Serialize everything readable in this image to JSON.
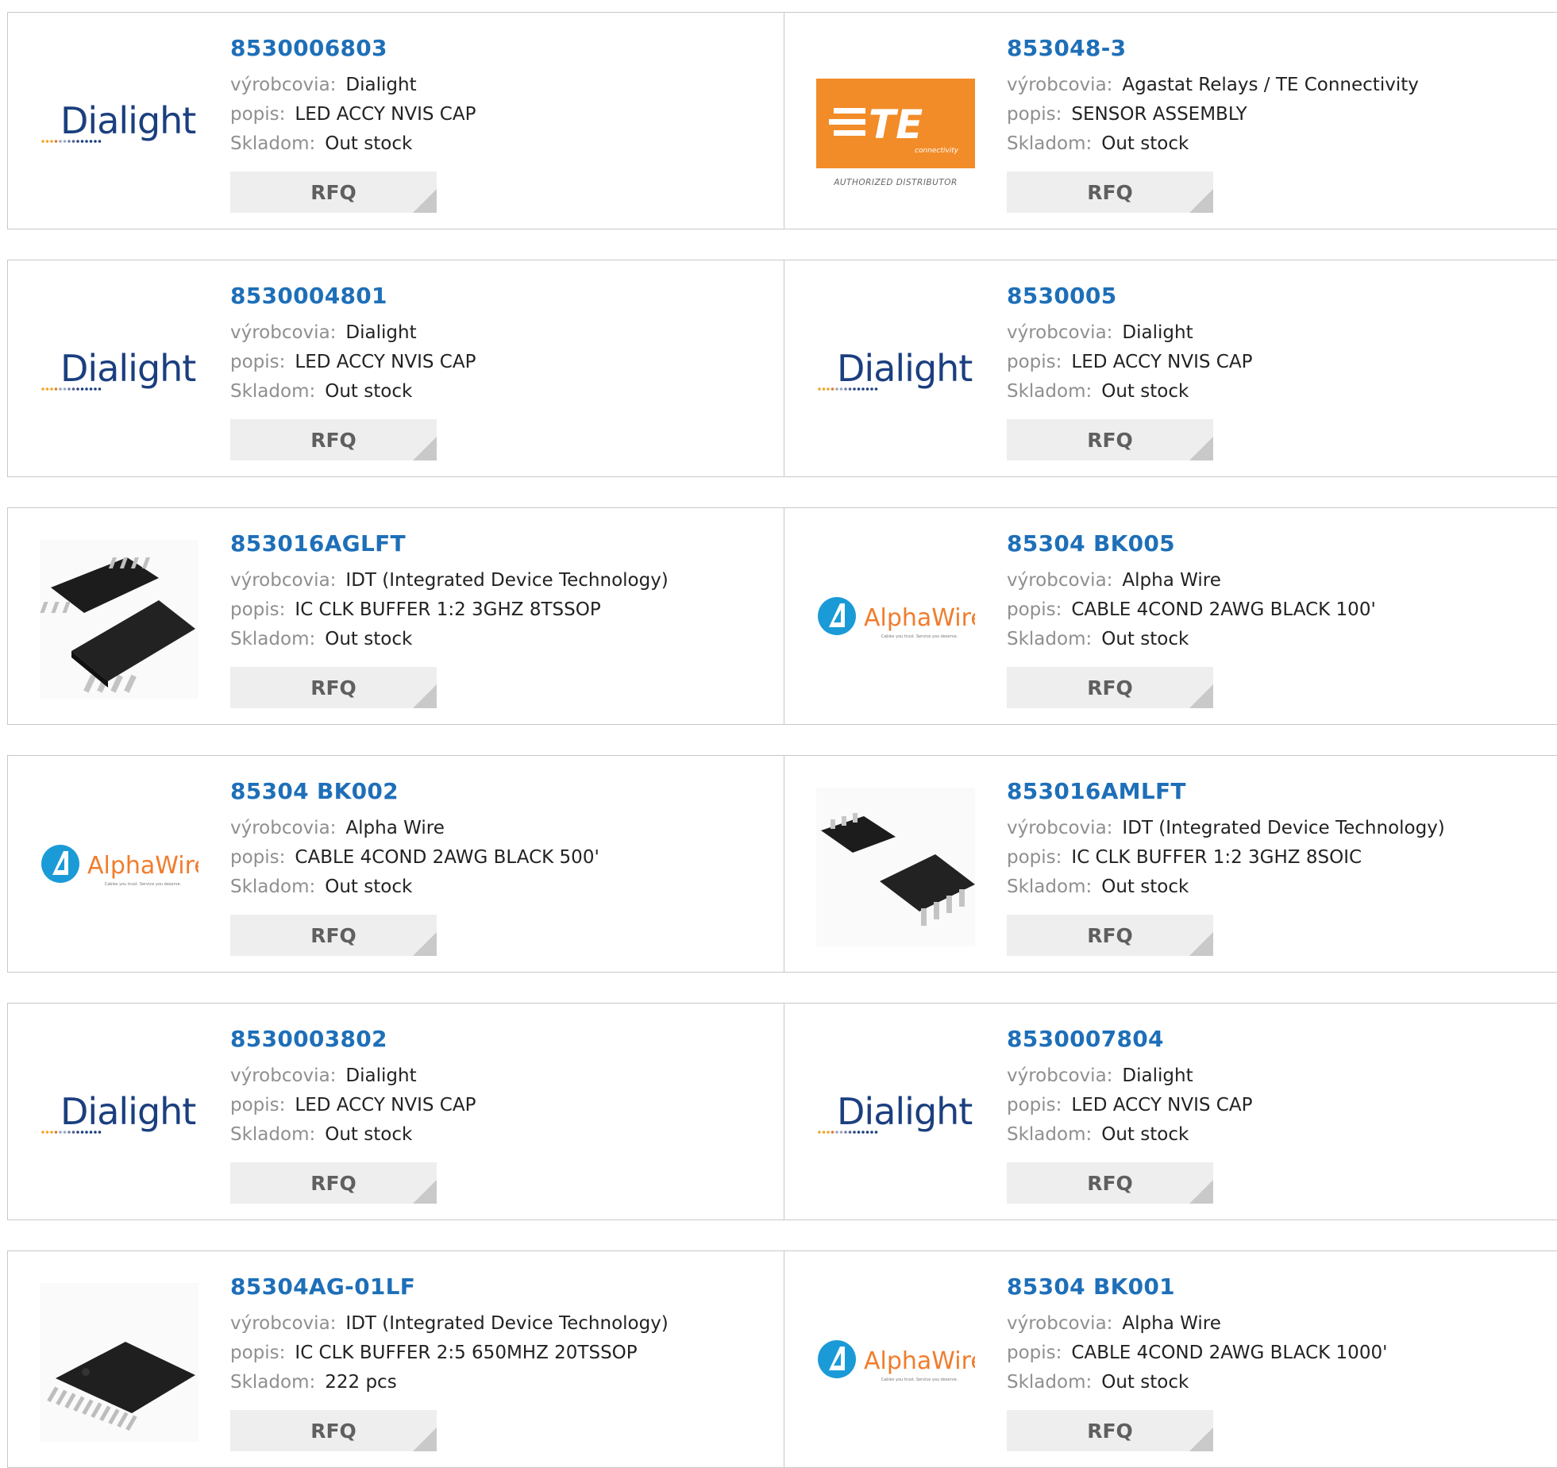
{
  "labels": {
    "manufacturer": "výrobcovia:",
    "description": "popis:",
    "stock": "Skladom:",
    "rfq": "RFQ"
  },
  "logos": {
    "dialight": "Dialight",
    "te_main": "TE",
    "te_sub": "connectivity",
    "te_caption": "AUTHORIZED DISTRIBUTOR",
    "alphawire": "AlphaWire",
    "alphawire_tagline": "Cables you trust. Service you deserve."
  },
  "colors": {
    "link": "#1e6fb8",
    "te_orange": "#f28c28",
    "alphawire_blue": "#1a9bd7",
    "alphawire_orange": "#f07d2d",
    "dialight_blue": "#1b3f7f"
  },
  "products": [
    {
      "part": "8530006803",
      "manufacturer": "Dialight",
      "description": "LED ACCY NVIS CAP",
      "stock": "Out stock",
      "image": "dialight-logo"
    },
    {
      "part": "853048-3",
      "manufacturer": "Agastat Relays / TE Connectivity",
      "description": "SENSOR ASSEMBLY",
      "stock": "Out stock",
      "image": "te-logo"
    },
    {
      "part": "8530004801",
      "manufacturer": "Dialight",
      "description": "LED ACCY NVIS CAP",
      "stock": "Out stock",
      "image": "dialight-logo"
    },
    {
      "part": "8530005",
      "manufacturer": "Dialight",
      "description": "LED ACCY NVIS CAP",
      "stock": "Out stock",
      "image": "dialight-logo"
    },
    {
      "part": "853016AGLFT",
      "manufacturer": "IDT (Integrated Device Technology)",
      "description": "IC CLK BUFFER 1:2 3GHZ 8TSSOP",
      "stock": "Out stock",
      "image": "chip-tssop8-photo"
    },
    {
      "part": "85304 BK005",
      "manufacturer": "Alpha Wire",
      "description": "CABLE 4COND 2AWG BLACK 100'",
      "stock": "Out stock",
      "image": "alphawire-logo"
    },
    {
      "part": "85304 BK002",
      "manufacturer": "Alpha Wire",
      "description": "CABLE 4COND 2AWG BLACK 500'",
      "stock": "Out stock",
      "image": "alphawire-logo"
    },
    {
      "part": "853016AMLFT",
      "manufacturer": "IDT (Integrated Device Technology)",
      "description": "IC CLK BUFFER 1:2 3GHZ 8SOIC",
      "stock": "Out stock",
      "image": "chip-soic8-photo"
    },
    {
      "part": "8530003802",
      "manufacturer": "Dialight",
      "description": "LED ACCY NVIS CAP",
      "stock": "Out stock",
      "image": "dialight-logo"
    },
    {
      "part": "8530007804",
      "manufacturer": "Dialight",
      "description": "LED ACCY NVIS CAP",
      "stock": "Out stock",
      "image": "dialight-logo"
    },
    {
      "part": "85304AG-01LF",
      "manufacturer": "IDT (Integrated Device Technology)",
      "description": "IC CLK BUFFER 2:5 650MHZ 20TSSOP",
      "stock": "222 pcs",
      "image": "chip-tssop20-photo"
    },
    {
      "part": "85304 BK001",
      "manufacturer": "Alpha Wire",
      "description": "CABLE 4COND 2AWG BLACK 1000'",
      "stock": "Out stock",
      "image": "alphawire-logo"
    }
  ]
}
